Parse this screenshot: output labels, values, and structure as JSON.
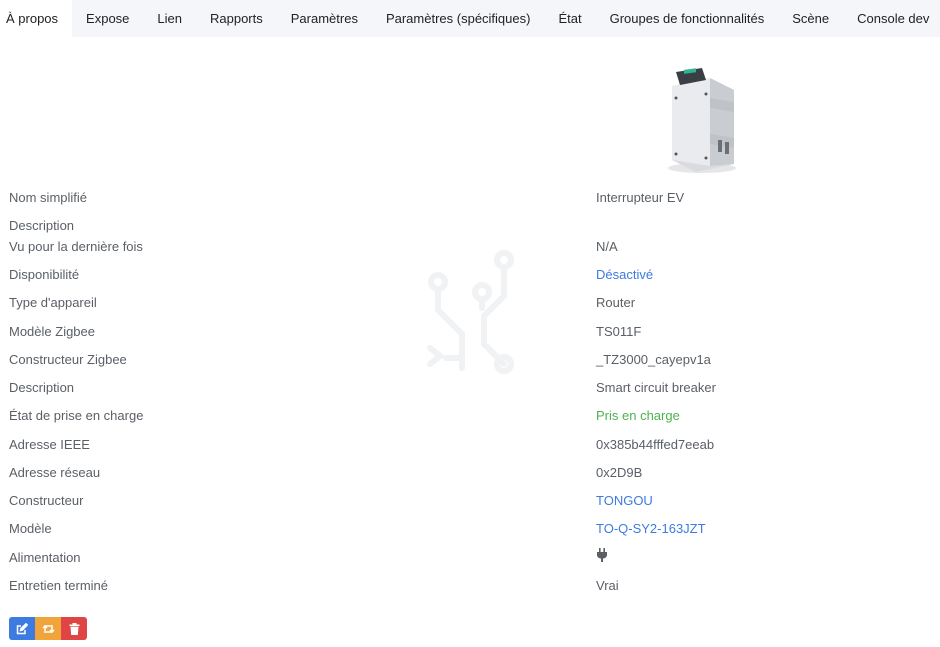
{
  "tabs": [
    {
      "label": "À propos",
      "active": true
    },
    {
      "label": "Expose"
    },
    {
      "label": "Lien"
    },
    {
      "label": "Rapports"
    },
    {
      "label": "Paramètres"
    },
    {
      "label": "Paramètres (spécifiques)"
    },
    {
      "label": "État"
    },
    {
      "label": "Groupes de fonctionnalités"
    },
    {
      "label": "Scène"
    },
    {
      "label": "Console dev"
    }
  ],
  "device": {
    "image_icon": "circuit-breaker-device-image"
  },
  "details": [
    {
      "label": "Nom simplifié",
      "value": "Interrupteur EV"
    },
    {
      "label": "Description",
      "value": ""
    },
    {
      "label": "Vu pour la dernière fois",
      "value": "N/A"
    },
    {
      "label": "Disponibilité",
      "value": "Désactivé"
    },
    {
      "label": "Type d'appareil",
      "value": "Router"
    },
    {
      "label": "Modèle Zigbee",
      "value": "TS011F"
    },
    {
      "label": "Constructeur Zigbee",
      "value": "_TZ3000_cayepv1a"
    },
    {
      "label": "Description",
      "value": "Smart circuit breaker"
    },
    {
      "label": "État de prise en charge",
      "value": "Pris en charge"
    },
    {
      "label": "Adresse IEEE",
      "value": "0x385b44fffed7eeab"
    },
    {
      "label": "Adresse réseau",
      "value": "0x2D9B"
    },
    {
      "label": "Constructeur",
      "value": "TONGOU"
    },
    {
      "label": "Modèle",
      "value": "TO-Q-SY2-163JZT"
    },
    {
      "label": "Alimentation",
      "value_icon": "plug-icon"
    },
    {
      "label": "Entretien terminé",
      "value": "Vrai"
    }
  ],
  "actions": {
    "edit_icon": "edit-icon",
    "swap_icon": "swap-icon",
    "delete_icon": "trash-icon"
  },
  "colors": {
    "link": "#3d7be0",
    "supported": "#4cb34f",
    "edit": "#3d7be0",
    "swap": "#f0a43a",
    "delete": "#e04545"
  }
}
